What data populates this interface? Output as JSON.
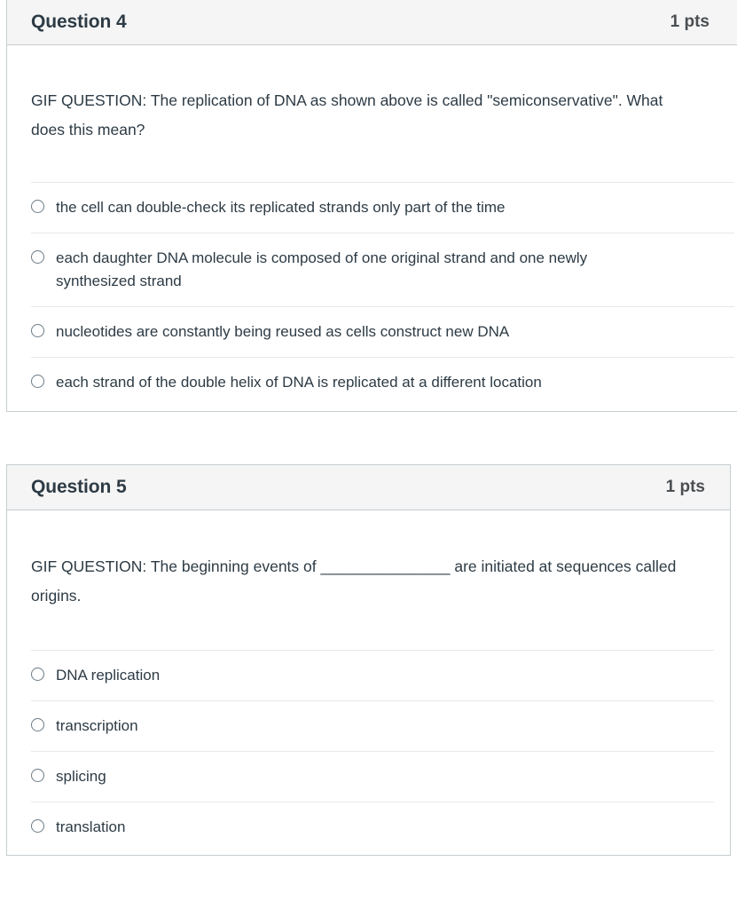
{
  "questions": [
    {
      "name": "Question 4",
      "points": "1 pts",
      "text": "GIF QUESTION: The replication of DNA as shown above is called \"semiconservative\".  What does this mean?",
      "options": [
        "the cell can double-check its replicated strands only part of the time",
        "each daughter DNA molecule is composed of one original strand and one newly synthesized strand",
        "nucleotides are constantly being reused as cells construct new DNA",
        "each strand of the double helix of DNA is replicated at a different location"
      ]
    },
    {
      "name": "Question 5",
      "points": "1 pts",
      "text": "GIF QUESTION: The beginning events of _______________ are initiated at sequences called origins.",
      "options": [
        "DNA replication",
        "transcription",
        "splicing",
        "translation"
      ]
    }
  ],
  "colors": {
    "header_background": "#f5f5f5",
    "card_border": "#c7cdd1",
    "text": "#2d3b45",
    "divider": "#e8e8e8",
    "radio_border": "#6b7b86"
  }
}
